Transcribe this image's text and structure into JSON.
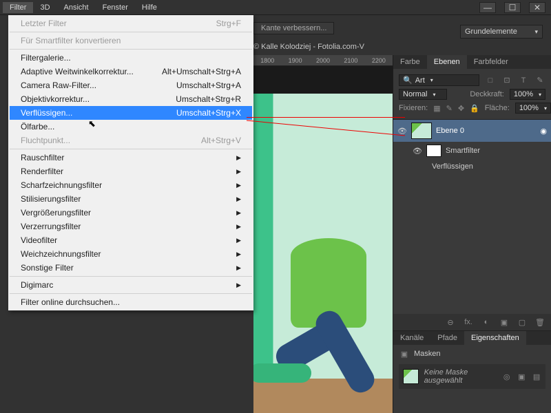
{
  "menubar": [
    "Filter",
    "3D",
    "Ansicht",
    "Fenster",
    "Hilfe"
  ],
  "window_buttons": [
    "—",
    "☐",
    "✕"
  ],
  "dropdown": {
    "sections": [
      [
        {
          "label": "Letzter Filter",
          "shortcut": "Strg+F",
          "disabled": true
        }
      ],
      [
        {
          "label": "Für Smartfilter konvertieren",
          "disabled": true
        }
      ],
      [
        {
          "label": "Filtergalerie..."
        },
        {
          "label": "Adaptive Weitwinkelkorrektur...",
          "shortcut": "Alt+Umschalt+Strg+A"
        },
        {
          "label": "Camera Raw-Filter...",
          "shortcut": "Umschalt+Strg+A"
        },
        {
          "label": "Objektivkorrektur...",
          "shortcut": "Umschalt+Strg+R"
        },
        {
          "label": "Verflüssigen...",
          "shortcut": "Umschalt+Strg+X",
          "hover": true
        },
        {
          "label": "Ölfarbe..."
        },
        {
          "label": "Fluchtpunkt...",
          "shortcut": "Alt+Strg+V",
          "disabled": true
        }
      ],
      [
        {
          "label": "Rauschfilter",
          "sub": true
        },
        {
          "label": "Renderfilter",
          "sub": true
        },
        {
          "label": "Scharfzeichnungsfilter",
          "sub": true
        },
        {
          "label": "Stilisierungsfilter",
          "sub": true
        },
        {
          "label": "Vergrößerungsfilter",
          "sub": true
        },
        {
          "label": "Verzerrungsfilter",
          "sub": true
        },
        {
          "label": "Videofilter",
          "sub": true
        },
        {
          "label": "Weichzeichnungsfilter",
          "sub": true
        },
        {
          "label": "Sonstige Filter",
          "sub": true
        }
      ],
      [
        {
          "label": "Digimarc",
          "sub": true
        }
      ],
      [
        {
          "label": "Filter online durchsuchen..."
        }
      ]
    ]
  },
  "toolstrip": {
    "refine": "Kante verbessern...",
    "fill": "Grundelemente"
  },
  "doc_tab": "© Kalle Kolodziej - Fotolia.com-V",
  "ruler": [
    "1800",
    "1900",
    "2000",
    "2100",
    "2200"
  ],
  "right": {
    "color_tabs": [
      "Farbe",
      "Ebenen",
      "Farbfelder"
    ],
    "art_dropdown": "Art",
    "tool_icons": [
      "□",
      "⊡",
      "T",
      "✎"
    ],
    "blend": {
      "label": "Normal",
      "opacity_label": "Deckkraft:",
      "opacity_val": "100%"
    },
    "lock": {
      "label": "Fixieren:",
      "fill_label": "Fläche:",
      "fill_val": "100%"
    },
    "layer0": "Ebene 0",
    "smartfilter": "Smartfilter",
    "verfl": "Verflüssigen",
    "foot": [
      "⊖",
      "fx.",
      "◐",
      "▣",
      "▢",
      "🗑"
    ],
    "props_tabs": [
      "Kanäle",
      "Pfade",
      "Eigenschaften"
    ],
    "masks": "Masken",
    "nomask": "Keine Maske ausgewählt",
    "props_foot": [
      "◎",
      "▣",
      "🗑"
    ]
  }
}
